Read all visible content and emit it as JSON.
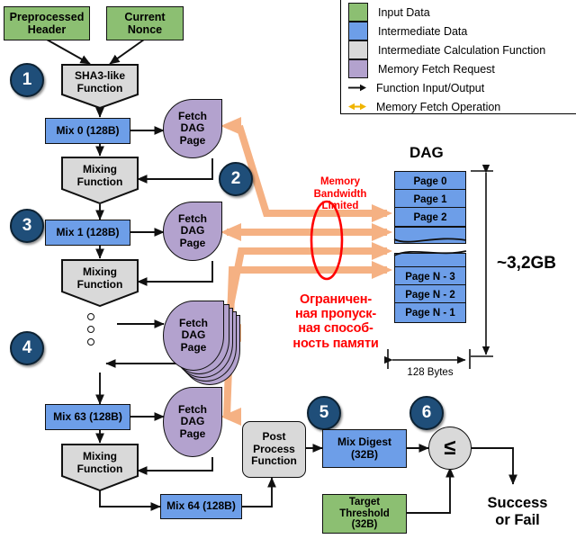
{
  "legend": {
    "items": [
      {
        "swatch": "#8CBF72",
        "label": "Input Data",
        "kind": "swatch"
      },
      {
        "swatch": "#6D9EE8",
        "label": "Intermediate Data",
        "kind": "swatch"
      },
      {
        "swatch": "#D9D9D9",
        "label": "Intermediate Calculation Function",
        "kind": "swatch"
      },
      {
        "swatch": "#B3A2CE",
        "label": "Memory Fetch Request",
        "kind": "swatch"
      },
      {
        "swatch": "#000000",
        "label": "Function Input/Output",
        "kind": "arrow-black"
      },
      {
        "swatch": "#F0B400",
        "label": "Memory Fetch Operation",
        "kind": "arrow-orange"
      }
    ]
  },
  "steps": {
    "one": "1",
    "two": "2",
    "three": "3",
    "four": "4",
    "five": "5",
    "six": "6"
  },
  "flow": {
    "preprocessed_header": "Preprocessed\nHeader",
    "preprocessed_header_l1": "Preprocessed",
    "preprocessed_header_l2": "Header",
    "current_nonce_l1": "Current",
    "current_nonce_l2": "Nonce",
    "sha3_l1": "SHA3-like",
    "sha3_l2": "Function",
    "mix0": "Mix 0 (128B)",
    "mix1": "Mix 1 (128B)",
    "mix63": "Mix 63 (128B)",
    "mix64": "Mix 64 (128B)",
    "mixing_l1": "Mixing",
    "mixing_l2": "Function",
    "fetch_l1": "Fetch",
    "fetch_l2": "DAG",
    "fetch_l3": "Page",
    "post_l1": "Post",
    "post_l2": "Process",
    "post_l3": "Function",
    "mix_digest_l1": "Mix Digest",
    "mix_digest_l2": "(32B)",
    "target_l1": "Target",
    "target_l2": "Threshold",
    "target_l3": "(32B)",
    "compare_op": "≤",
    "result_l1": "Success",
    "result_l2": "or Fail"
  },
  "dag": {
    "title": "DAG",
    "pages_top": [
      "Page 0",
      "Page 1",
      "Page 2"
    ],
    "pages_bottom": [
      "Page N - 3",
      "Page N - 2",
      "Page N - 1"
    ],
    "total_size": "~3,2GB",
    "page_width_label": "128 Bytes"
  },
  "annotations": {
    "memory_bandwidth_limited_l1": "Memory",
    "memory_bandwidth_limited_l2": "Bandwidth",
    "memory_bandwidth_limited_l3": "Limited",
    "russian_l1": "Ограничен-",
    "russian_l2": "ная пропуск-",
    "russian_l3": "ная способ-",
    "russian_l4": "ность памяти"
  },
  "colors": {
    "input_data": "#8CBF72",
    "intermediate_data": "#6D9EE8",
    "calc_function": "#D9D9D9",
    "memory_fetch": "#B3A2CE",
    "badge": "#1F4E79",
    "fetch_arrow": "#F5B183",
    "legend_arrow": "#F0B400",
    "alert": "#FF0000"
  }
}
